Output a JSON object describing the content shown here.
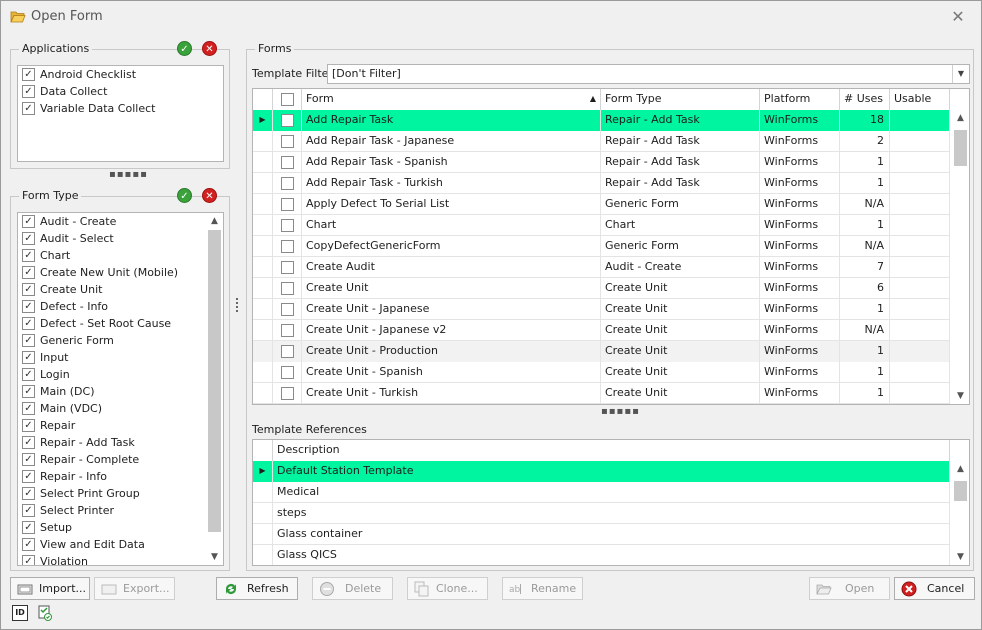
{
  "window": {
    "title": "Open Form",
    "close_glyph": "✕"
  },
  "applications": {
    "title": "Applications",
    "items": [
      {
        "label": "Android Checklist",
        "checked": true
      },
      {
        "label": "Data Collect",
        "checked": true
      },
      {
        "label": "Variable Data Collect",
        "checked": true
      }
    ]
  },
  "form_type": {
    "title": "Form Type",
    "items": [
      {
        "label": "Audit - Create",
        "checked": true
      },
      {
        "label": "Audit - Select",
        "checked": true
      },
      {
        "label": "Chart",
        "checked": true
      },
      {
        "label": "Create New Unit (Mobile)",
        "checked": true
      },
      {
        "label": "Create Unit",
        "checked": true
      },
      {
        "label": "Defect - Info",
        "checked": true
      },
      {
        "label": "Defect - Set Root Cause",
        "checked": true
      },
      {
        "label": "Generic Form",
        "checked": true
      },
      {
        "label": "Input",
        "checked": true
      },
      {
        "label": "Login",
        "checked": true
      },
      {
        "label": "Main (DC)",
        "checked": true
      },
      {
        "label": "Main (VDC)",
        "checked": true
      },
      {
        "label": "Repair",
        "checked": true
      },
      {
        "label": "Repair - Add Task",
        "checked": true
      },
      {
        "label": "Repair - Complete",
        "checked": true
      },
      {
        "label": "Repair - Info",
        "checked": true
      },
      {
        "label": "Select Print Group",
        "checked": true
      },
      {
        "label": "Select Printer",
        "checked": true
      },
      {
        "label": "Setup",
        "checked": true
      },
      {
        "label": "View and Edit Data",
        "checked": true
      },
      {
        "label": "Violation",
        "checked": true
      }
    ]
  },
  "forms": {
    "title": "Forms",
    "filter_label": "Template Filter",
    "filter_value": "[Don't Filter]",
    "columns": [
      "Form",
      "Form Type",
      "Platform",
      "# Uses",
      "Usable"
    ],
    "rows": [
      {
        "form": "Add Repair Task",
        "type": "Repair - Add Task",
        "platform": "WinForms",
        "uses": "18"
      },
      {
        "form": "Add Repair Task - Japanese",
        "type": "Repair - Add Task",
        "platform": "WinForms",
        "uses": "2"
      },
      {
        "form": "Add Repair Task - Spanish",
        "type": "Repair - Add Task",
        "platform": "WinForms",
        "uses": "1"
      },
      {
        "form": "Add Repair Task - Turkish",
        "type": "Repair - Add Task",
        "platform": "WinForms",
        "uses": "1"
      },
      {
        "form": "Apply Defect To Serial List",
        "type": "Generic Form",
        "platform": "WinForms",
        "uses": "N/A"
      },
      {
        "form": "Chart",
        "type": "Chart",
        "platform": "WinForms",
        "uses": "1"
      },
      {
        "form": "CopyDefectGenericForm",
        "type": "Generic Form",
        "platform": "WinForms",
        "uses": "N/A"
      },
      {
        "form": "Create Audit",
        "type": "Audit - Create",
        "platform": "WinForms",
        "uses": "7"
      },
      {
        "form": "Create Unit",
        "type": "Create Unit",
        "platform": "WinForms",
        "uses": "6"
      },
      {
        "form": "Create Unit - Japanese",
        "type": "Create Unit",
        "platform": "WinForms",
        "uses": "1"
      },
      {
        "form": "Create Unit - Japanese v2",
        "type": "Create Unit",
        "platform": "WinForms",
        "uses": "N/A"
      },
      {
        "form": "Create Unit - Production",
        "type": "Create Unit",
        "platform": "WinForms",
        "uses": "1"
      },
      {
        "form": "Create Unit - Spanish",
        "type": "Create Unit",
        "platform": "WinForms",
        "uses": "1"
      },
      {
        "form": "Create Unit - Turkish",
        "type": "Create Unit",
        "platform": "WinForms",
        "uses": "1"
      }
    ]
  },
  "template_references": {
    "title": "Template References",
    "column": "Description",
    "rows": [
      "Default Station Template",
      "Medical",
      "steps",
      "Glass container",
      "Glass QICS"
    ]
  },
  "buttons": {
    "import": "Import...",
    "export": "Export...",
    "refresh": "Refresh",
    "delete": "Delete",
    "clone": "Clone...",
    "rename": "Rename",
    "open": "Open",
    "cancel": "Cancel"
  },
  "status": {
    "id_label": "ID"
  },
  "colors": {
    "selection": "#00f5a0",
    "check_green": "#3aa23a",
    "cancel_red": "#d02020"
  }
}
